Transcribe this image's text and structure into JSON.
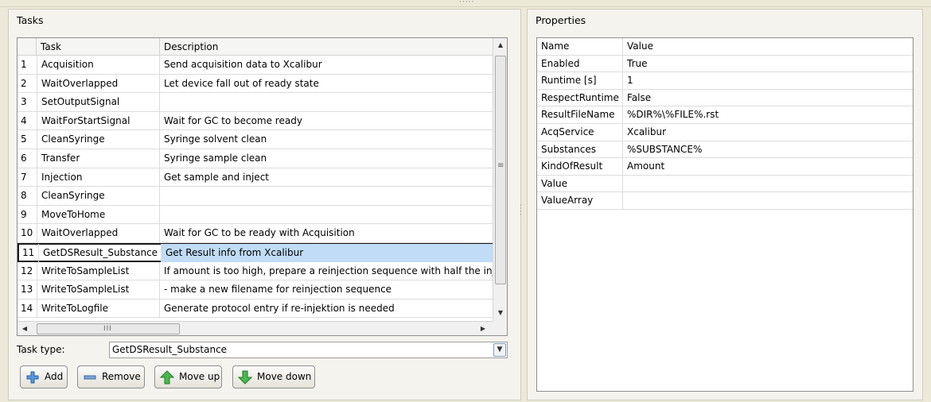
{
  "tasks_panel": {
    "title": "Tasks",
    "columns": {
      "num": "",
      "task": "Task",
      "description": "Description"
    },
    "rows": [
      {
        "num": "1",
        "task": "Acquisition",
        "description": "Send acquisition data to Xcalibur"
      },
      {
        "num": "2",
        "task": "WaitOverlapped",
        "description": "Let device fall out of ready state"
      },
      {
        "num": "3",
        "task": "SetOutputSignal",
        "description": ""
      },
      {
        "num": "4",
        "task": "WaitForStartSignal",
        "description": "Wait for GC to become ready"
      },
      {
        "num": "5",
        "task": "CleanSyringe",
        "description": "Syringe solvent clean"
      },
      {
        "num": "6",
        "task": "Transfer",
        "description": "Syringe sample clean"
      },
      {
        "num": "7",
        "task": "Injection",
        "description": "Get sample and inject"
      },
      {
        "num": "8",
        "task": "CleanSyringe",
        "description": ""
      },
      {
        "num": "9",
        "task": "MoveToHome",
        "description": ""
      },
      {
        "num": "10",
        "task": "WaitOverlapped",
        "description": "Wait for GC to be ready with Acquisition"
      },
      {
        "num": "11",
        "task": "GetDSResult_Substance",
        "description": "Get Result info from Xcalibur"
      },
      {
        "num": "12",
        "task": "WriteToSampleList",
        "description": "If amount is too high, prepare a reinjection sequence with half the inj"
      },
      {
        "num": "13",
        "task": "WriteToSampleList",
        "description": "- make a new filename for reinjection sequence"
      },
      {
        "num": "14",
        "task": "WriteToLogfile",
        "description": "Generate protocol entry if re-injektion is needed"
      }
    ],
    "selected_row": "11",
    "task_type_label": "Task type:",
    "task_type_value": "GetDSResult_Substance",
    "buttons": {
      "add": "Add",
      "remove": "Remove",
      "move_up": "Move up",
      "move_down": "Move down"
    }
  },
  "properties_panel": {
    "title": "Properties",
    "columns": {
      "name": "Name",
      "value": "Value"
    },
    "rows": [
      {
        "name": "Enabled",
        "value": "True"
      },
      {
        "name": "Runtime [s]",
        "value": "1"
      },
      {
        "name": "RespectRuntime",
        "value": "False"
      },
      {
        "name": "ResultFileName",
        "value": "%DIR%\\%FILE%.rst"
      },
      {
        "name": "AcqService",
        "value": "Xcalibur"
      },
      {
        "name": "Substances",
        "value": "%SUBSTANCE%"
      },
      {
        "name": "KindOfResult",
        "value": "Amount"
      },
      {
        "name": "Value",
        "value": ""
      },
      {
        "name": "ValueArray",
        "value": ""
      }
    ]
  },
  "colors": {
    "selection": "#c1dcf6",
    "add_icon": "#3f7fd0",
    "move_icon": "#35a83a"
  }
}
